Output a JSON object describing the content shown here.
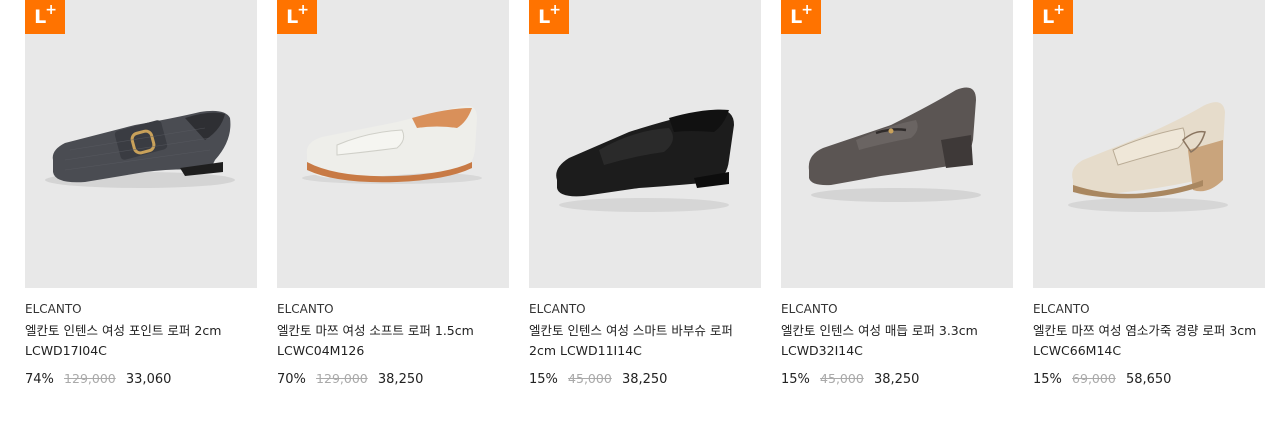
{
  "badge": {
    "text": "L",
    "plus": "+",
    "color": "#ff7300"
  },
  "products": [
    {
      "brand": "ELCANTO",
      "name": "엘칸토 인텐스 여성 포인트 로퍼 2cm LCWD17I04C",
      "discount": "74%",
      "original_price": "129,000",
      "sale_price": "33,060",
      "shoe_color": "#4a4c52"
    },
    {
      "brand": "ELCANTO",
      "name": "엘칸토 마쯔 여성 소프트 로퍼 1.5cm LCWC04M126",
      "discount": "70%",
      "original_price": "129,000",
      "sale_price": "38,250",
      "shoe_color": "#eeeeea"
    },
    {
      "brand": "ELCANTO",
      "name": "엘칸토 인텐스 여성 스마트 바부슈 로퍼 2cm LCWD11I14C",
      "discount": "15%",
      "original_price": "45,000",
      "sale_price": "38,250",
      "shoe_color": "#1c1c1c"
    },
    {
      "brand": "ELCANTO",
      "name": "엘칸토 인텐스 여성 매듭 로퍼 3.3cm LCWD32I14C",
      "discount": "15%",
      "original_price": "45,000",
      "sale_price": "38,250",
      "shoe_color": "#5b5553"
    },
    {
      "brand": "ELCANTO",
      "name": "엘칸토 마쯔 여성 염소가죽 경량 로퍼 3cm LCWC66M14C",
      "discount": "15%",
      "original_price": "69,000",
      "sale_price": "58,650",
      "shoe_color": "#e6dccb"
    }
  ]
}
